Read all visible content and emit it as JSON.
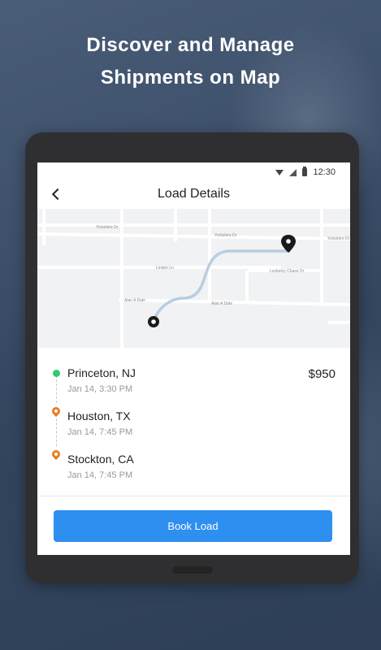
{
  "headline": {
    "line1": "Discover and Manage",
    "line2": "Shipments on Map"
  },
  "statusbar": {
    "time": "12:30",
    "icons": [
      "wifi-icon",
      "signal-icon",
      "battery-icon"
    ]
  },
  "appbar": {
    "title": "Load Details",
    "back_icon": "chevron-left-icon"
  },
  "map": {
    "streets": [
      "Yorkshire Dr",
      "Yorkshire Dr",
      "Yorkshire Dr",
      "Linden Ln",
      "Lockeley Chase Dr",
      "Alan A Dale",
      "Alan A Dale"
    ],
    "route_color": "#b9cde0",
    "pin_color": "#1a1a1a"
  },
  "stops": [
    {
      "city": "Princeton, NJ",
      "time": "Jan 14, 3:30 PM",
      "marker": "green-dot",
      "color": "#2ecc71"
    },
    {
      "city": "Houston, TX",
      "time": "Jan 14, 7:45 PM",
      "marker": "location-pin-icon",
      "color": "#e67e22"
    },
    {
      "city": "Stockton, CA",
      "time": "Jan 14, 7:45 PM",
      "marker": "location-pin-icon",
      "color": "#e67e22"
    }
  ],
  "price": "$950",
  "book_button": {
    "label": "Book Load",
    "color": "#2d8ff0"
  }
}
